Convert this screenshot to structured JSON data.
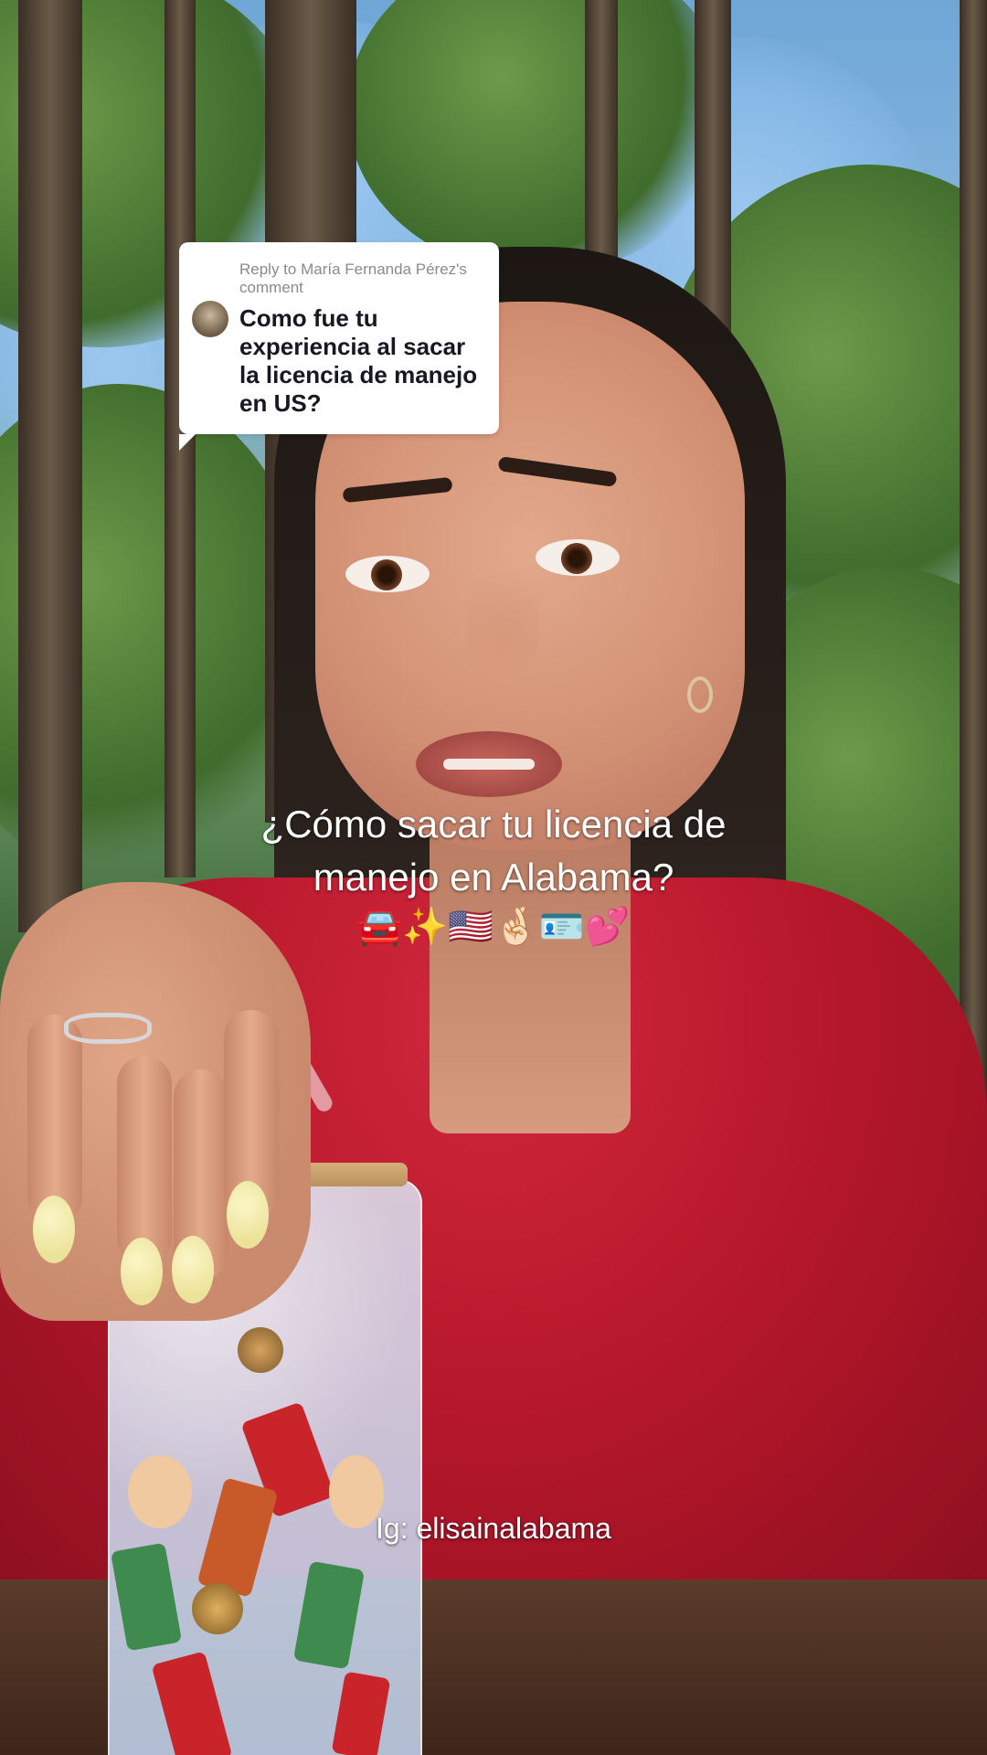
{
  "reply": {
    "header": "Reply to María Fernanda Pérez's comment",
    "comment": "Como fue tu experiencia al sacar la licencia de manejo en US?"
  },
  "captions": {
    "line1": "¿Cómo sacar tu licencia de",
    "line2": "manejo en Alabama?",
    "emojis": "🚘✨🇺🇸🤞🏻🪪💕"
  },
  "handle": "Ig: elisainalabama"
}
